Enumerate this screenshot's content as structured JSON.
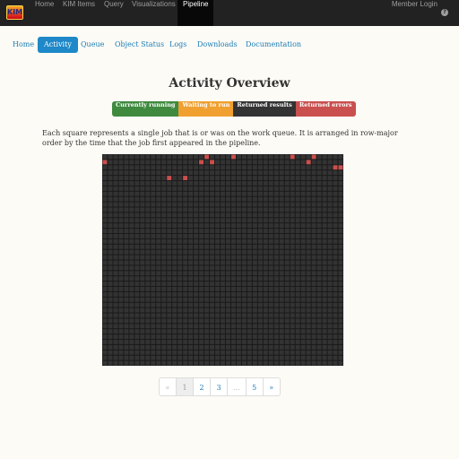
{
  "navbar": {
    "logo_text": "KIM",
    "items": [
      "Home",
      "KIM Items",
      "Query",
      "Visualizations",
      "Pipeline"
    ],
    "login": "Member Login",
    "help_icon": "?"
  },
  "subnav": [
    "Home",
    "Activity",
    "Queue",
    "Object Status",
    "Logs",
    "Downloads",
    "Documentation"
  ],
  "page_title": "Activity Overview",
  "legend": {
    "running": "Currently running",
    "waiting": "Waiting to run",
    "returned": "Returned results",
    "errors": "Returned errors"
  },
  "description": "Each square represents a single job that is or was on the work queue. It is arranged in row-major order by the time that the job first appeared in the pipeline.",
  "grid": {
    "columns": 45,
    "rows": 40,
    "colors": {
      "returned": "#333333",
      "errors": "#c9504e"
    },
    "error_cells": [
      [
        0,
        19
      ],
      [
        0,
        24
      ],
      [
        0,
        35
      ],
      [
        0,
        39
      ],
      [
        1,
        0
      ],
      [
        1,
        18
      ],
      [
        1,
        20
      ],
      [
        1,
        38
      ],
      [
        2,
        43
      ],
      [
        2,
        44
      ],
      [
        4,
        12
      ],
      [
        4,
        15
      ]
    ]
  },
  "pagination": [
    "«",
    "1",
    "2",
    "3",
    "...",
    "5",
    "»"
  ]
}
